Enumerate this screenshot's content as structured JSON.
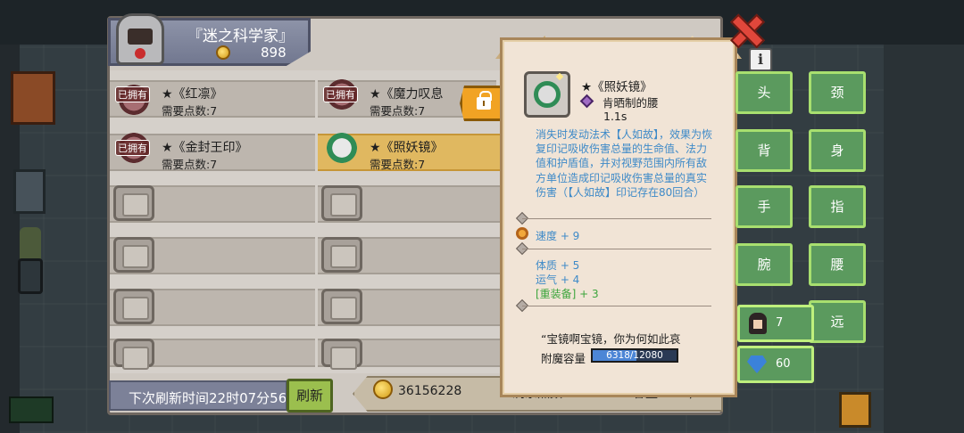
{
  "player": {
    "title": "『迷之科学家』",
    "gold": "898"
  },
  "items": [
    {
      "name": "★《红凛》",
      "points": "需要点数:7",
      "owned": "已拥有",
      "selected": false
    },
    {
      "name": "★《魔力叹息",
      "points": "需要点数:7",
      "owned": "已拥有",
      "selected": false
    },
    {
      "name": "★《金封王印》",
      "points": "需要点数:7",
      "owned": "已拥有",
      "selected": false
    },
    {
      "name": "★《照妖镜》",
      "points": "需要点数:7",
      "owned": "",
      "selected": true
    }
  ],
  "footer": {
    "refresh_time": "下次刷新时间22时07分56",
    "refresh_button": "刷新",
    "coins": "36156228",
    "remaining_points": "剩余点数:25",
    "capacity": "容量: 171/200"
  },
  "tooltip": {
    "name": "★《照妖镜》",
    "slot": "肯晒制的腰",
    "cooldown": "1.1s",
    "description": "消失时发动法术【人如故】，效果为恢复印记吸收伤害总量的生命值、法力值和护盾值，并对视野范围内所有敌方单位造成印记吸收伤害总量的真实伤害（【人如故】印记存在80回合）",
    "stats_group1": [
      "速度 + 9"
    ],
    "stats_group2": [
      "体质 + 5",
      "运气 + 4",
      "[重装备] + 3"
    ],
    "quote": "“宝镜啊宝镜，你为何如此哀",
    "enchant_label": "附魔容量",
    "enchant_value": "6318/12080",
    "enchant_fraction": 0.523
  },
  "equipment_slots": [
    "头",
    "颈",
    "背",
    "身",
    "手",
    "指",
    "腕",
    "腰",
    "远"
  ],
  "currency": {
    "characters": "7",
    "gems": "60"
  },
  "colors": {
    "selected_row": "#e0b860",
    "desc_blue": "#3e8ac8",
    "stat_green": "#3ca53c",
    "slot_green": "#5b9a5e"
  },
  "icons": [
    "close-icon",
    "info-icon",
    "lock-icon",
    "coin-icon",
    "gem-icon"
  ]
}
